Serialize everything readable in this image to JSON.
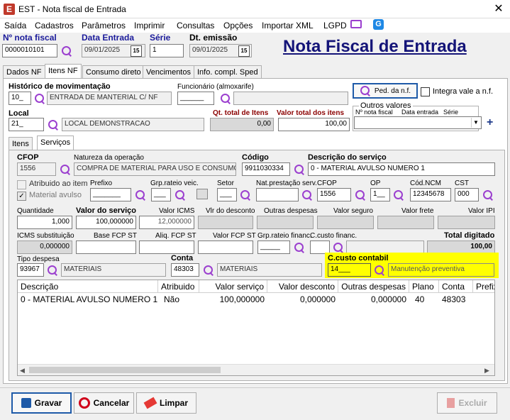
{
  "window": {
    "title": "EST - Nota fiscal de Entrada",
    "close": "✕"
  },
  "menu": [
    "Saída",
    "Cadastros",
    "Parâmetros",
    "Imprimir",
    "Consultas",
    "Opções",
    "Importar XML",
    "LGPD"
  ],
  "header": {
    "nota_label": "Nº nota fiscal",
    "nota_value": "0000010101",
    "data_entrada_label": "Data Entrada",
    "data_entrada_value": "09/01/2025",
    "serie_label": "Série",
    "serie_value": "1",
    "dt_emissao_label": "Dt. emissão",
    "dt_emissao_value": "09/01/2025",
    "big_title": "Nota Fiscal de Entrada"
  },
  "tabs": [
    "Dados NF",
    "Itens NF",
    "Consumo direto",
    "Vencimentos",
    "Info. compl. Sped"
  ],
  "itens": {
    "historico_label": "Histórico de movimentação",
    "historico_code": "10_",
    "historico_desc": "ENTRADA DE MANTERIAL C/ NF",
    "funcionario_label": "Funcionário (almoxarife)",
    "funcionario_value": "______",
    "ped_nf_label": "Ped. da n.f.",
    "integra_label": "Integra vale a n.f.",
    "local_label": "Local",
    "local_code": "21_",
    "local_desc": "LOCAL DEMONSTRACAO",
    "qt_total_label": "Qt. total de Itens",
    "qt_total_value": "0,00",
    "valor_total_label": "Valor total dos itens",
    "valor_total_value": "100,00",
    "outros_valores_label": "Outros valores",
    "outros_cols": [
      "Nº nota fiscal",
      "Data entrada",
      "Série"
    ],
    "subtabs": [
      "Itens",
      "Serviços"
    ]
  },
  "servicos": {
    "cfop_label": "CFOP",
    "cfop_value": "1556",
    "natureza_label": "Natureza da operação",
    "natureza_value": "COMPRA DE MATERIAL PARA USO E CONSUMO - A",
    "codigo_label": "Código",
    "codigo_value": "9911030334",
    "descricao_label": "Descrição do serviço",
    "descricao_value": "0 - MATERIAL AVULSO NUMERO 1",
    "atribuido_label": "Atribuido ao item",
    "material_avulso_label": "Material avulso",
    "prefixo_label": "Prefixo",
    "prefixo_value": "_______",
    "grp_rateio_label": "Grp.rateio veic.",
    "grp_rateio_value": "___",
    "setor_label": "Setor",
    "setor_value": "___",
    "nat_prest_label": "Nat.prestação serv.",
    "nat_prest_value": "",
    "cfop2_label": "CFOP",
    "cfop2_value": "1556",
    "op_label": "OP",
    "op_value": "1__",
    "cod_ncm_label": "Cód.NCM",
    "cod_ncm_value": "12345678",
    "cst_label": "CST",
    "cst_value": "000",
    "quantidade_label": "Quantidade",
    "quantidade_value": "1,000",
    "valor_servico_label": "Valor do serviço",
    "valor_servico_value": "100,000000",
    "valor_icms_label": "Valor ICMS",
    "valor_icms_value": "12,000000",
    "vlr_desconto_label": "Vlr do desconto",
    "vlr_desconto_value": "",
    "outras_despesas_label": "Outras despesas",
    "outras_despesas_value": "",
    "valor_seguro_label": "Valor seguro",
    "valor_seguro_value": "",
    "valor_frete_label": "Valor frete",
    "valor_frete_value": "",
    "valor_ipi_label": "Valor IPI",
    "valor_ipi_value": "",
    "icms_subst_label": "ICMS substituição",
    "icms_subst_value": "0,000000",
    "base_fcp_label": "Base FCP ST",
    "aliq_fcp_label": "Aliq. FCP ST",
    "valor_fcp_label": "Valor FCP ST",
    "grp_financ_label": "Grp.rateio financ.",
    "grp_financ_value": "_____",
    "ccusto_financ_label": "C.custo financ.",
    "ccusto_financ_value": "",
    "total_digitado_label": "Total digitado",
    "total_digitado_value": "100,00",
    "tipo_despesa_label": "Tipo despesa",
    "tipo_despesa_code": "93967",
    "tipo_despesa_desc": "MATERIAIS",
    "conta_label": "Conta",
    "conta_code": "48303",
    "conta_desc": "MATERIAIS",
    "ccusto_contabil_label": "C.custo contabil",
    "ccusto_contabil_code": "14___",
    "ccusto_contabil_desc": "Manutenção preventiva"
  },
  "grid": {
    "columns": [
      "Descrição",
      "Atribuido",
      "Valor serviço",
      "Valor desconto",
      "Outras despesas",
      "Plano",
      "Conta",
      "Prefixo"
    ],
    "rows": [
      [
        "0 - MATERIAL AVULSO NUMERO 1",
        "Não",
        "100,000000",
        "0,000000",
        "0,000000",
        "40",
        "48303",
        ""
      ]
    ]
  },
  "footer": {
    "gravar": "Gravar",
    "cancelar": "Cancelar",
    "limpar": "Limpar",
    "excluir": "Excluir"
  }
}
